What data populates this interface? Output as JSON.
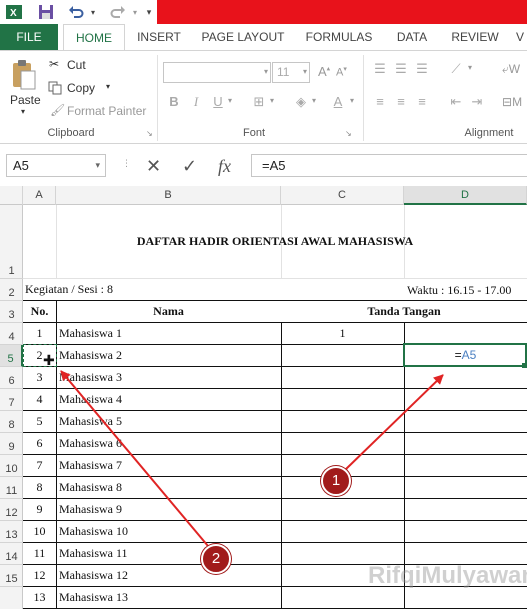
{
  "quick_access": {
    "app_icon": "excel-icon",
    "save_icon": "save-icon",
    "undo_icon": "undo-icon",
    "redo_icon": "redo-icon",
    "customize_icon": "customize-qat-icon"
  },
  "colors": {
    "brand": "#217346",
    "title_bar": "#e8121b",
    "callout": "#a11b1b",
    "arrow": "#e02424",
    "formula_ref": "#4a7fc1"
  },
  "tabs": [
    "FILE",
    "HOME",
    "INSERT",
    "PAGE LAYOUT",
    "FORMULAS",
    "DATA",
    "REVIEW",
    "V"
  ],
  "clipboard": {
    "paste": "Paste",
    "cut": "Cut",
    "copy": "Copy",
    "format_painter": "Format Painter",
    "label": "Clipboard"
  },
  "font": {
    "size": "11",
    "label": "Font",
    "bold": "B",
    "italic": "I",
    "underline": "U"
  },
  "alignment": {
    "label": "Alignment",
    "wrap": "W",
    "merge": "M"
  },
  "formula_bar": {
    "name_box": "A5",
    "cancel": "✕",
    "enter": "✓",
    "fx": "fx",
    "formula": "=A5"
  },
  "columns": [
    "A",
    "B",
    "C",
    "D"
  ],
  "rows": [
    "1",
    "2",
    "3",
    "4",
    "5",
    "6",
    "7",
    "8",
    "9",
    "10",
    "11",
    "12",
    "13",
    "14",
    "15"
  ],
  "sheet": {
    "title": "DAFTAR HADIR ORIENTASI AWAL MAHASISWA",
    "kegiatan": "Kegiatan / Sesi : 8",
    "waktu": "Waktu : 16.15 - 17.00",
    "hdr_no": "No.",
    "hdr_nama": "Nama",
    "hdr_ttd": "Tanda Tangan",
    "c4_value": "1",
    "d5_eq": "=",
    "d5_ref": "A5",
    "students": [
      {
        "no": "1",
        "nama": "Mahasiswa 1"
      },
      {
        "no": "2",
        "nama": "Mahasiswa 2"
      },
      {
        "no": "3",
        "nama": "Mahasiswa 3"
      },
      {
        "no": "4",
        "nama": "Mahasiswa 4"
      },
      {
        "no": "5",
        "nama": "Mahasiswa 5"
      },
      {
        "no": "6",
        "nama": "Mahasiswa 6"
      },
      {
        "no": "7",
        "nama": "Mahasiswa 7"
      },
      {
        "no": "8",
        "nama": "Mahasiswa 8"
      },
      {
        "no": "9",
        "nama": "Mahasiswa 9"
      },
      {
        "no": "10",
        "nama": "Mahasiswa 10"
      },
      {
        "no": "11",
        "nama": "Mahasiswa 11"
      },
      {
        "no": "12",
        "nama": "Mahasiswa 12"
      },
      {
        "no": "13",
        "nama": "Mahasiswa 13"
      }
    ]
  },
  "callouts": [
    "1",
    "2"
  ],
  "watermark": "RifqiMulyawan"
}
